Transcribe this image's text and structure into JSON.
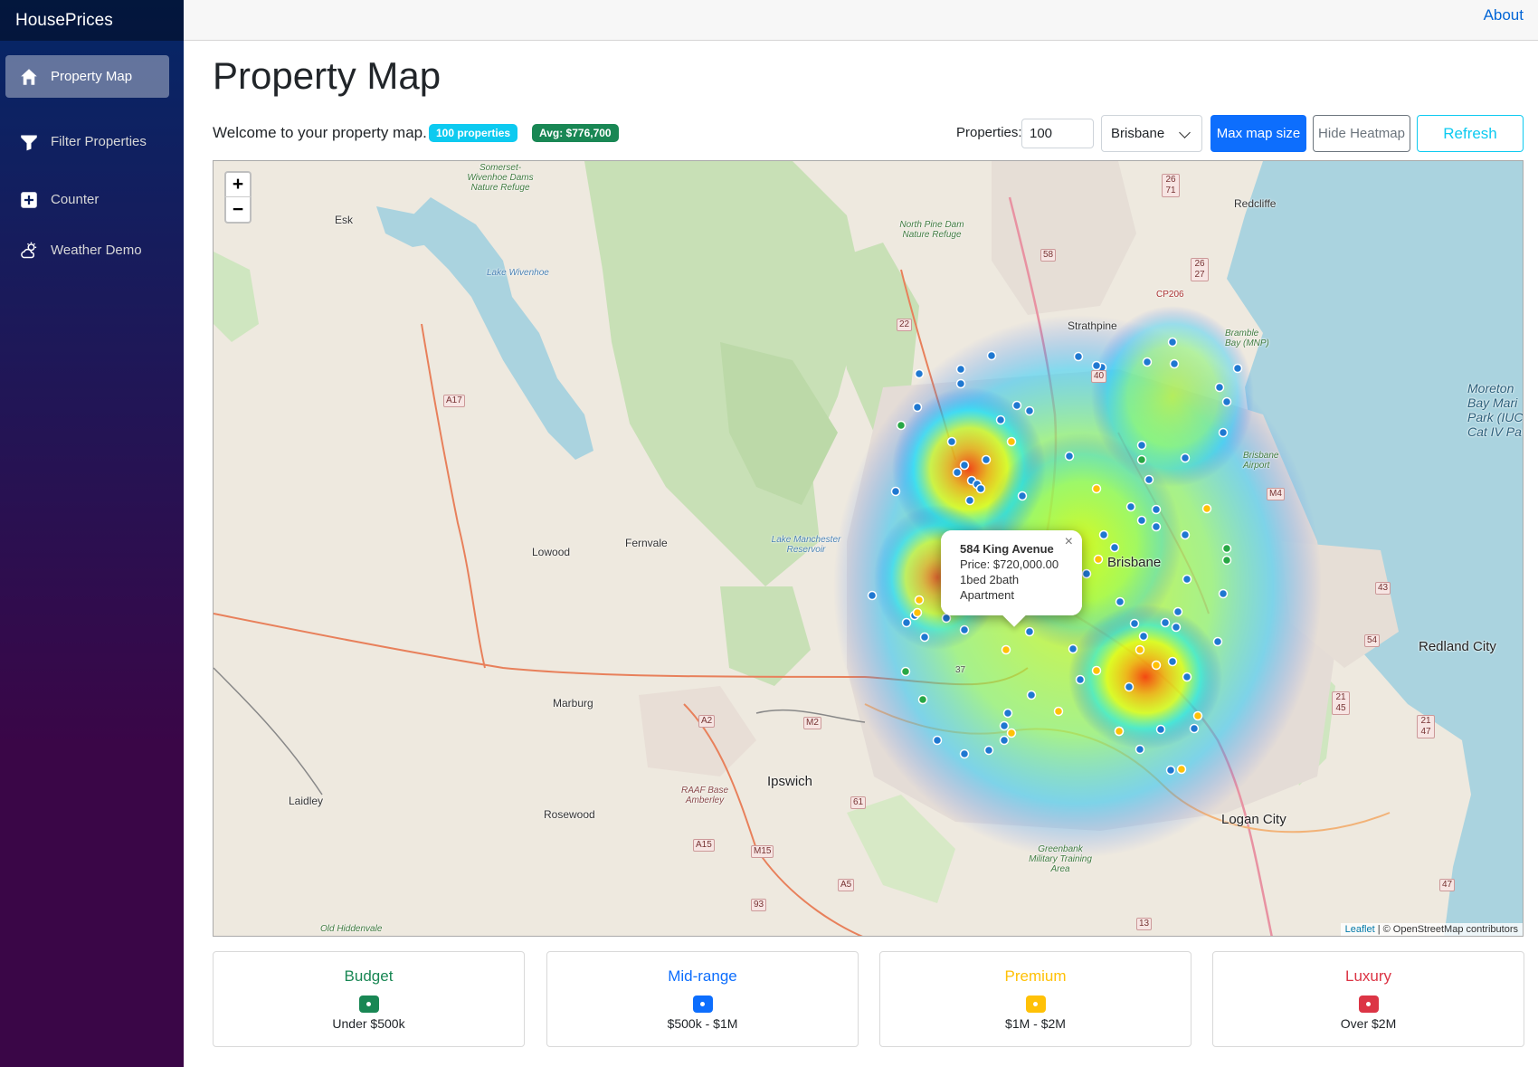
{
  "app": {
    "brand": "HousePrices"
  },
  "topbar": {
    "about_label": "About"
  },
  "sidebar": {
    "items": [
      {
        "label": "Property Map",
        "icon": "home-icon",
        "active": true
      },
      {
        "label": "Filter Properties",
        "icon": "funnel-icon",
        "active": false
      },
      {
        "label": "Counter",
        "icon": "plus-square-icon",
        "active": false
      },
      {
        "label": "Weather Demo",
        "icon": "cloud-sun-icon",
        "active": false
      }
    ]
  },
  "main": {
    "title": "Property Map",
    "welcome": "Welcome to your property map.",
    "badge_count": "100 properties",
    "badge_avg": "Avg: $776,700"
  },
  "controls": {
    "properties_label": "Properties:",
    "properties_value": "100",
    "city_selected": "Brisbane",
    "max_map_label": "Max map size",
    "hide_heatmap_label": "Hide Heatmap",
    "refresh_label": "Refresh"
  },
  "map": {
    "zoom_in": "+",
    "zoom_out": "−",
    "places": {
      "esk": "Esk",
      "lowood": "Lowood",
      "fernvale": "Fernvale",
      "marburg": "Marburg",
      "laidley": "Laidley",
      "rosewood": "Rosewood",
      "ipswich": "Ipswich",
      "brisbane": "Brisbane",
      "strathpine": "Strathpine",
      "redcliffe": "Redcliffe",
      "redland": "Redland City",
      "logan": "Logan City",
      "lake_wivenhoe": "Lake Wivenhoe",
      "lake_manchester": "Lake Manchester Reservoir",
      "somerset": "Somerset-Wivenhoe Dams Nature Refuge",
      "north_pine": "North Pine Dam Nature Refuge",
      "raaf": "RAAF Base Amberley",
      "greenbank": "Greenbank Military Training Area",
      "moreton": "Moreton Bay Mari Park (IUC Cat IV Pa",
      "old_hiddenvale": "Old Hiddenvale",
      "brisbane_airport": "Brisbane Airport",
      "bramble_bay": "Bramble Bay (MNP)"
    },
    "roads": [
      "A17",
      "A2",
      "M2",
      "A15",
      "M15",
      "A5",
      "93",
      "61",
      "22",
      "58",
      "40",
      "26 27",
      "M4",
      "43",
      "54",
      "21 45",
      "21 47",
      "47",
      "13",
      "CP206",
      "26 71",
      "37"
    ],
    "popup": {
      "title": "584 King Avenue",
      "price": "Price: $720,000.00",
      "beds": "1bed 2bath",
      "type": "Apartment",
      "close": "×"
    },
    "attribution": {
      "leaflet": "Leaflet",
      "rest": " | © OpenStreetMap contributors"
    }
  },
  "legend": [
    {
      "title": "Budget",
      "range": "Under $500k",
      "color": "#198754"
    },
    {
      "title": "Mid-range",
      "range": "$500k - $1M",
      "color": "#0d6efd"
    },
    {
      "title": "Premium",
      "range": "$1M - $2M",
      "color": "#ffc107"
    },
    {
      "title": "Luxury",
      "range": "Over $2M",
      "color": "#dc3545"
    }
  ]
}
